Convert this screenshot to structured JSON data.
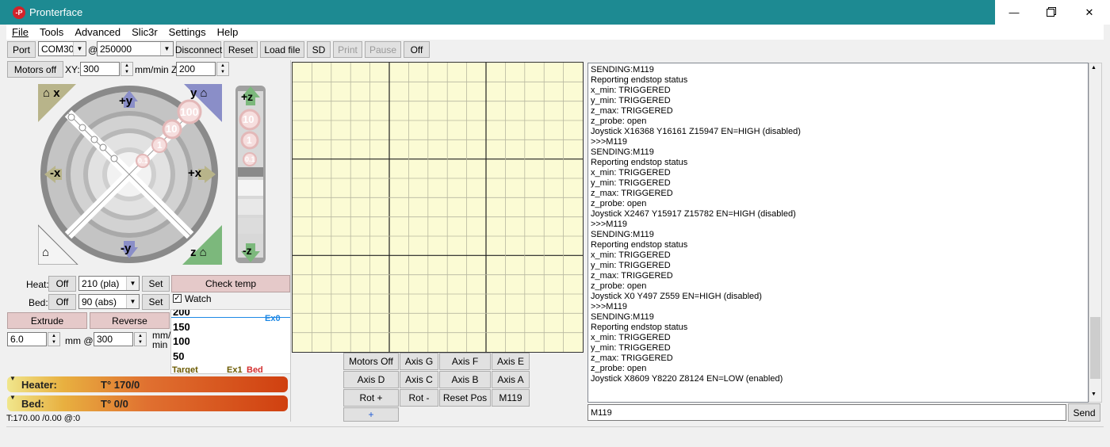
{
  "window": {
    "title": "Pronterface",
    "icon_text": "-P"
  },
  "menu": [
    "File",
    "Tools",
    "Advanced",
    "Slic3r",
    "Settings",
    "Help"
  ],
  "toolbar": {
    "port_label": "Port",
    "port_value": "COM30",
    "at": "@",
    "baud_value": "250000",
    "disconnect": "Disconnect",
    "reset": "Reset",
    "load_file": "Load file",
    "sd": "SD",
    "print": "Print",
    "pause": "Pause",
    "off": "Off"
  },
  "motion": {
    "motors_off": "Motors off",
    "xy_label": "XY:",
    "xy_value": "300",
    "mmmin_z": "mm/min Z:",
    "z_value": "200"
  },
  "jog": {
    "home_x": "x",
    "home_y": "y",
    "home_z": "z",
    "plus_y": "+y",
    "minus_y": "-y",
    "plus_x": "+x",
    "minus_x": "-x",
    "plus_z": "+z",
    "minus_z": "-z",
    "steps": [
      "100",
      "10",
      "1",
      "0.1"
    ],
    "z_steps": [
      "10",
      "1",
      "0.1"
    ]
  },
  "temp": {
    "heat_label": "Heat:",
    "heat_off": "Off",
    "heat_value": "210 (pla)",
    "set": "Set",
    "bed_label": "Bed:",
    "bed_off": "Off",
    "bed_value": "90 (abs)",
    "check_temp": "Check temp",
    "watch": "Watch"
  },
  "extrude": {
    "extrude": "Extrude",
    "reverse": "Reverse",
    "length": "6.0",
    "mm_at": "mm @",
    "speed": "300",
    "mm_min": "mm/\nmin"
  },
  "graph": {
    "ticks": [
      "200",
      "150",
      "100",
      "50"
    ],
    "legend_ex0": "Ex0",
    "legend_target": "Target",
    "legend_ex1": "Ex1",
    "legend_bed": "Bed"
  },
  "gauges": {
    "heater_label": "Heater:",
    "heater_value": "T° 170/0",
    "bed_label": "Bed:",
    "bed_value": "T° 0/0"
  },
  "status_line": "T:170.00 /0.00 @:0",
  "macros": [
    [
      "Motors Off",
      "Axis G",
      "Axis F",
      "Axis E"
    ],
    [
      "Axis D",
      "Axis C",
      "Axis B",
      "Axis A"
    ],
    [
      "Rot +",
      "Rot -",
      "Reset Pos",
      "M119"
    ],
    [
      "+"
    ]
  ],
  "console_lines": [
    "SENDING:M119",
    "Reporting endstop status",
    "x_min: TRIGGERED",
    "y_min: TRIGGERED",
    "z_max: TRIGGERED",
    "z_probe: open",
    "Joystick X16368 Y16161 Z15947 EN=HIGH (disabled)",
    ">>>M119",
    "SENDING:M119",
    "Reporting endstop status",
    "x_min: TRIGGERED",
    "y_min: TRIGGERED",
    "z_max: TRIGGERED",
    "z_probe: open",
    "Joystick X2467 Y15917 Z15782 EN=HIGH (disabled)",
    ">>>M119",
    "SENDING:M119",
    "Reporting endstop status",
    "x_min: TRIGGERED",
    "y_min: TRIGGERED",
    "z_max: TRIGGERED",
    "z_probe: open",
    "Joystick X0 Y497 Z559 EN=HIGH (disabled)",
    ">>>M119",
    "SENDING:M119",
    "Reporting endstop status",
    "x_min: TRIGGERED",
    "y_min: TRIGGERED",
    "z_max: TRIGGERED",
    "z_probe: open",
    "Joystick X8609 Y8220 Z8124 EN=LOW (enabled)"
  ],
  "command": {
    "value": "M119",
    "send": "Send"
  },
  "colors": {
    "titlebar": "#1d8a92",
    "grid_bg": "#fbfbd4",
    "ex0": "#1e88e5",
    "bed": "#d32f2f"
  }
}
